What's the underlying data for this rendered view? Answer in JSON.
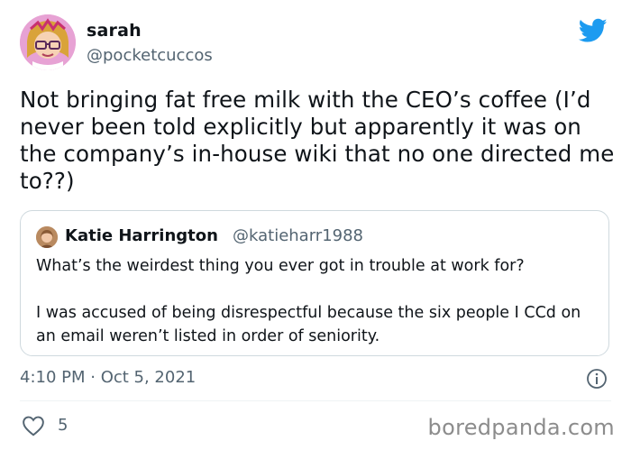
{
  "author": {
    "name": "sarah",
    "handle": "@pocketcuccos"
  },
  "tweet": {
    "text": "Not bringing fat free milk with the CEO’s coffee (I’d never been told explicitly but apparently it was on the company’s in-house wiki that no one directed me to??)"
  },
  "quoted": {
    "name": "Katie Harrington",
    "handle": "@katieharr1988",
    "paragraphs": [
      "What’s the weirdest thing you ever got in trouble at work for?",
      "I was accused of being disrespectful because the six people I CCd on an email weren’t listed in order of seniority."
    ]
  },
  "meta": {
    "timestamp": "4:10 PM · Oct 5, 2021",
    "like_count": "5"
  },
  "watermark": "boredpanda.com",
  "colors": {
    "brand": "#1d9bf0",
    "muted": "#536471",
    "border": "#cfd9de"
  },
  "icons": [
    "twitter-bird-icon",
    "info-icon",
    "heart-icon"
  ]
}
